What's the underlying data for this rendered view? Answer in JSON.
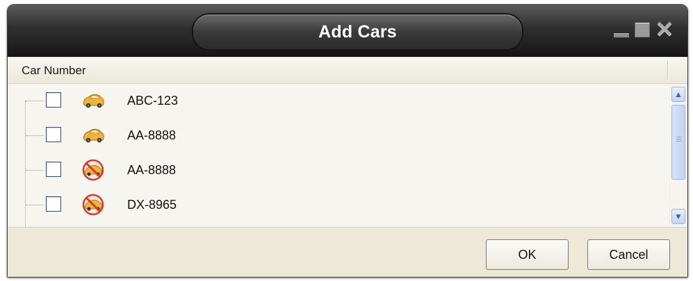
{
  "window": {
    "title": "Add Cars",
    "controls": {
      "minimize": "minimize-icon",
      "maximize": "maximize-icon",
      "close": "close-icon"
    }
  },
  "table": {
    "column_header": "Car Number",
    "rows": [
      {
        "label": "ABC-123",
        "checked": false,
        "icon": "car-icon",
        "status": "available"
      },
      {
        "label": "AA-8888",
        "checked": false,
        "icon": "car-icon",
        "status": "available"
      },
      {
        "label": "AA-8888",
        "checked": false,
        "icon": "car-disabled-icon",
        "status": "unavailable"
      },
      {
        "label": "DX-8965",
        "checked": false,
        "icon": "car-disabled-icon",
        "status": "unavailable"
      }
    ]
  },
  "buttons": {
    "ok": "OK",
    "cancel": "Cancel"
  },
  "colors": {
    "titlebar": "#2f2f2f",
    "car_body": "#f0b536",
    "forbid_red": "#d93a2b",
    "scrollbar": "#c3d4f2"
  }
}
